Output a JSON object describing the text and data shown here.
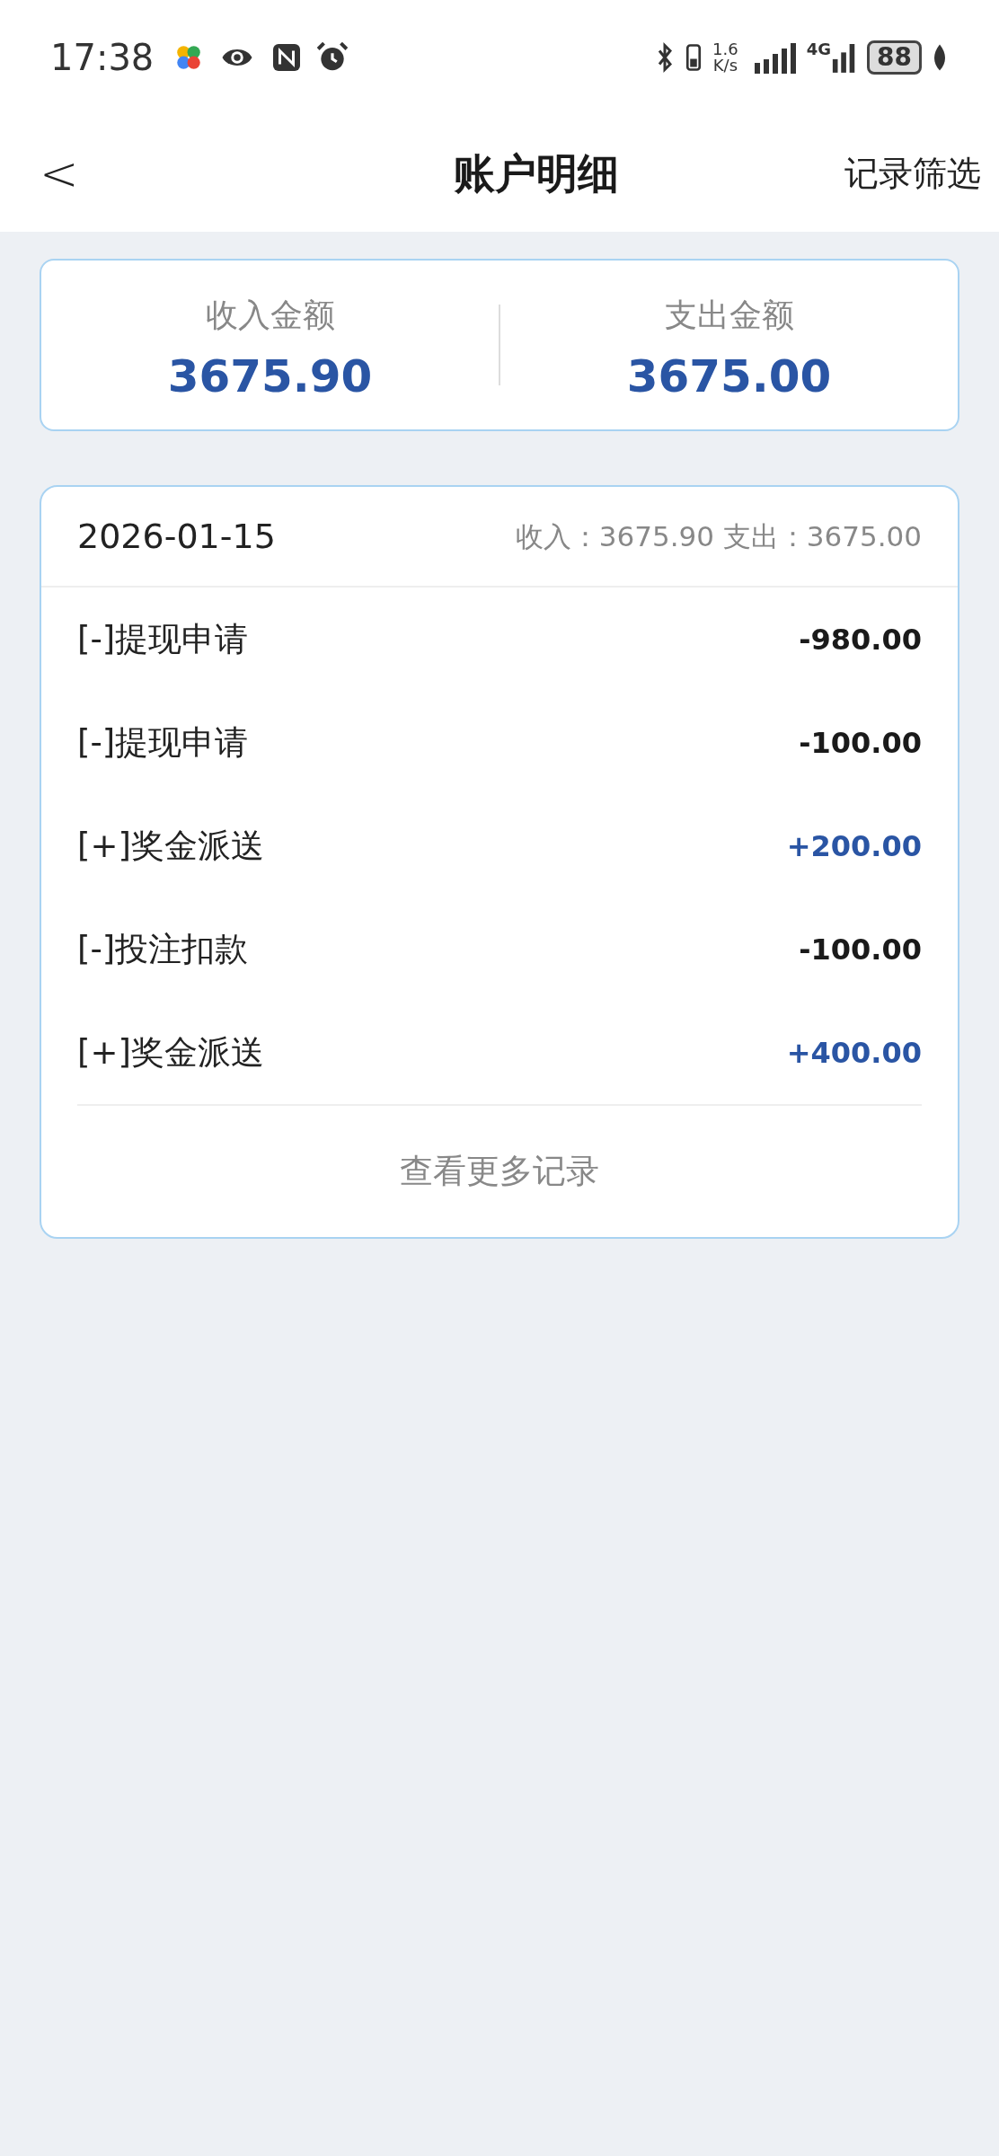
{
  "status_bar": {
    "time": "17:38",
    "net_speed_value": "1.6",
    "net_speed_unit": "K/s",
    "network_type": "4G",
    "battery": "88"
  },
  "header": {
    "back": "<",
    "title": "账户明细",
    "filter_button": "记录筛选"
  },
  "summary": [
    {
      "label": "收入金额",
      "value": "3675.90"
    },
    {
      "label": "支出金额",
      "value": "3675.00"
    }
  ],
  "day_group": {
    "date": "2026-01-15",
    "totals": "收入：3675.90 支出：3675.00",
    "entries": [
      {
        "kind": "expense",
        "title": "[-]提现申请",
        "amount": "-980.00"
      },
      {
        "kind": "expense",
        "title": "[-]提现申请",
        "amount": "-100.00"
      },
      {
        "kind": "income",
        "title": "[+]奖金派送",
        "amount": "+200.00"
      },
      {
        "kind": "expense",
        "title": "[-]投注扣款",
        "amount": "-100.00"
      },
      {
        "kind": "income",
        "title": "[+]奖金派送",
        "amount": "+400.00"
      }
    ],
    "more_button": "查看更多记录"
  }
}
